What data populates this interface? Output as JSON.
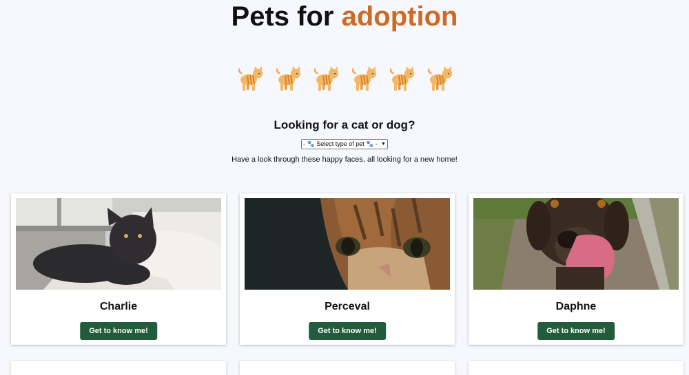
{
  "header": {
    "title_prefix": "Pets for",
    "title_accent": "adoption",
    "accent_color": "#cf6a26"
  },
  "decor": {
    "cat_icons": [
      "cat-icon",
      "cat-icon",
      "cat-icon",
      "cat-icon",
      "cat-icon",
      "cat-icon"
    ]
  },
  "filter": {
    "heading": "Looking for a cat or dog?",
    "select_value": "- 🐾 Select type of pet 🐾 -",
    "intro": "Have a look through these happy faces, all looking for a new home!"
  },
  "pets": [
    {
      "name": "Charlie",
      "button": "Get to know me!",
      "photo": "black-cat-photo"
    },
    {
      "name": "Perceval",
      "button": "Get to know me!",
      "photo": "tabby-cat-photo"
    },
    {
      "name": "Daphne",
      "button": "Get to know me!",
      "photo": "brown-dog-photo"
    }
  ],
  "colors": {
    "background": "#f6f8fd",
    "button": "#225c3c"
  }
}
